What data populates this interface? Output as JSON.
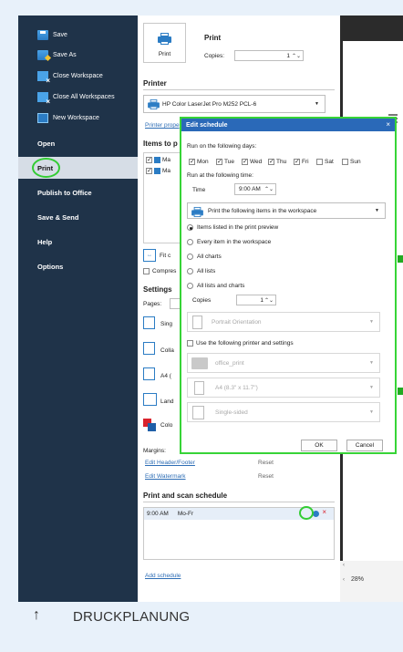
{
  "sidebar": {
    "items": [
      {
        "label": "Save",
        "icon": "save-icon"
      },
      {
        "label": "Save As",
        "icon": "save-as-icon"
      },
      {
        "label": "Close Workspace",
        "icon": "close-workspace-icon"
      },
      {
        "label": "Close All Workspaces",
        "icon": "close-all-workspaces-icon"
      },
      {
        "label": "New Workspace",
        "icon": "new-workspace-icon"
      }
    ],
    "sections": [
      "Open",
      "Print",
      "Publish to Office",
      "Save & Send",
      "Help",
      "Options"
    ],
    "active": "Print"
  },
  "print": {
    "button_label": "Print",
    "title": "Print",
    "copies_label": "Copies:",
    "copies_value": "1"
  },
  "printer": {
    "heading": "Printer",
    "name": "HP Color LaserJet Pro M252 PCL-6",
    "properties_link": "Printer prope"
  },
  "items": {
    "heading": "Items to p",
    "rows": [
      "Ma",
      "Ma"
    ],
    "fit_label": "Fit c",
    "compress_label": "Compres"
  },
  "settings": {
    "heading": "Settings",
    "pages_label": "Pages:",
    "tiles": [
      "Sing",
      "Colla",
      "A4 (",
      "Land",
      "Colo"
    ],
    "margins_label": "Margins:",
    "edit_header_footer": "Edit Header/Footer",
    "edit_watermark": "Edit Watermark",
    "reset_label": "Reset"
  },
  "schedule": {
    "heading": "Print and scan schedule",
    "entry_time": "9:00 AM",
    "entry_days": "Mo-Fr",
    "add_link": "Add schedule"
  },
  "preview": {
    "zoom": "28%"
  },
  "dialog": {
    "title": "Edit schedule",
    "close_glyph": "×",
    "run_days_label": "Run on the following days:",
    "days": [
      {
        "label": "Mon",
        "checked": true
      },
      {
        "label": "Tue",
        "checked": true
      },
      {
        "label": "Wed",
        "checked": true
      },
      {
        "label": "Thu",
        "checked": true
      },
      {
        "label": "Fri",
        "checked": true
      },
      {
        "label": "Sat",
        "checked": false
      },
      {
        "label": "Sun",
        "checked": false
      }
    ],
    "run_time_label": "Run at the following time:",
    "time_label": "Time",
    "time_value": "9:00 AM",
    "action_select": "Print the following items in the workspace",
    "radios": [
      {
        "label": "Items listed in the print preview",
        "checked": true
      },
      {
        "label": "Every item in the workspace",
        "checked": false
      },
      {
        "label": "All charts",
        "checked": false
      },
      {
        "label": "All lists",
        "checked": false
      },
      {
        "label": "All lists and charts",
        "checked": false
      }
    ],
    "copies_label": "Copies",
    "copies_value": "1",
    "orientation": "Portrait Orientation",
    "use_printer_label": "Use the following printer and settings",
    "printer_value": "office_print",
    "paper_value": "A4 (8.3\" x 11.7\")",
    "sides_value": "Single-sided",
    "ok_label": "OK",
    "cancel_label": "Cancel"
  },
  "footer": {
    "label": "DRUCKPLANUNG",
    "arrow": "↑"
  }
}
